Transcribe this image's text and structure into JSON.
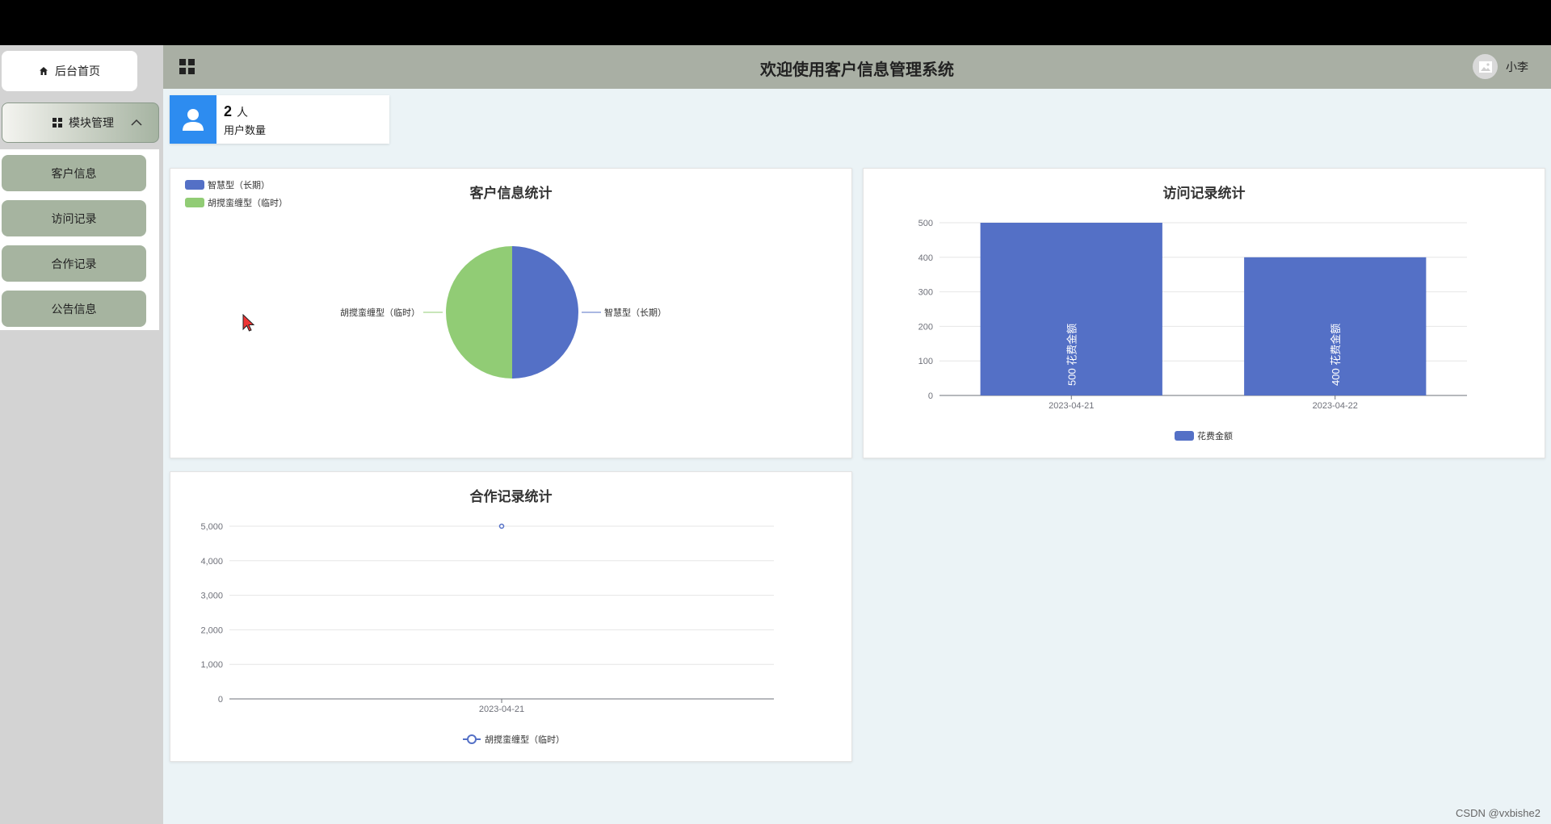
{
  "sidebar": {
    "home_label": "后台首页",
    "module_label": "模块管理",
    "items": [
      {
        "label": "客户信息"
      },
      {
        "label": "访问记录"
      },
      {
        "label": "合作记录"
      },
      {
        "label": "公告信息"
      }
    ]
  },
  "header": {
    "title": "欢迎使用客户信息管理系统",
    "user_name": "小李"
  },
  "stat_card": {
    "count": "2",
    "unit": "人",
    "label": "用户数量",
    "accent": "#2d8cf0"
  },
  "colors": {
    "blue": "#5470c6",
    "green": "#91cc75"
  },
  "chart_data": [
    {
      "type": "pie",
      "title": "客户信息统计",
      "legend_position": "top-left",
      "slices": [
        {
          "name": "智慧型（长期）",
          "value": 1,
          "color": "#5470c6"
        },
        {
          "name": "胡搅蛮缠型（临时）",
          "value": 1,
          "color": "#91cc75"
        }
      ]
    },
    {
      "type": "bar",
      "title": "访问记录统计",
      "legend_position": "bottom",
      "categories": [
        "2023-04-21",
        "2023-04-22"
      ],
      "series": [
        {
          "name": "花费金额",
          "values": [
            500,
            400
          ],
          "color": "#5470c6"
        }
      ],
      "y_ticks": [
        "0",
        "100",
        "200",
        "300",
        "400",
        "500"
      ],
      "ylim": [
        0,
        500
      ],
      "bar_labels": [
        "500  花费金额",
        "400  花费金额"
      ]
    },
    {
      "type": "line",
      "title": "合作记录统计",
      "legend_position": "bottom",
      "categories": [
        "2023-04-21"
      ],
      "series": [
        {
          "name": "胡搅蛮缠型（临时）",
          "values": [
            5000
          ],
          "color": "#5470c6"
        }
      ],
      "y_ticks": [
        "0",
        "1,000",
        "2,000",
        "3,000",
        "4,000",
        "5,000"
      ],
      "ylim": [
        0,
        5000
      ]
    }
  ],
  "watermark": "CSDN @vxbishe2"
}
